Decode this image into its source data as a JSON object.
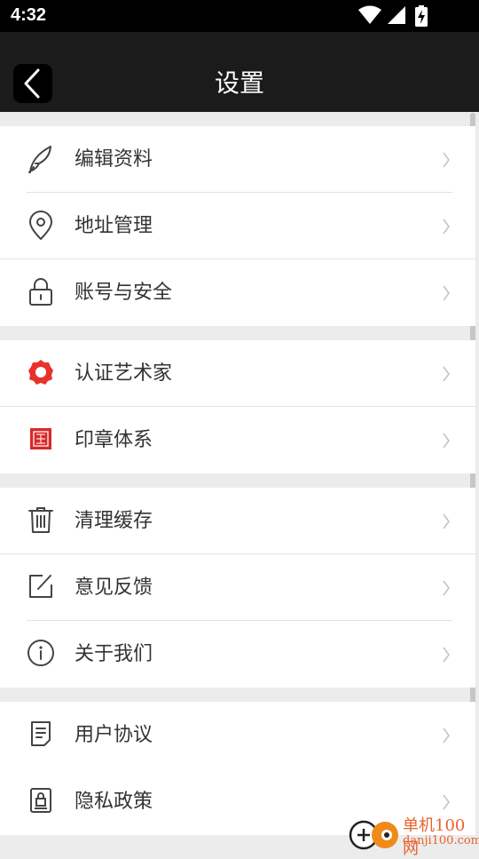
{
  "status_bar": {
    "time": "4:32"
  },
  "header": {
    "title": "设置",
    "back_icon": "chevron-left-icon"
  },
  "groups": [
    {
      "items": [
        {
          "label": "编辑资料",
          "icon": "quill-pen-icon"
        },
        {
          "label": "地址管理",
          "icon": "location-pin-icon"
        },
        {
          "label": "账号与安全",
          "icon": "padlock-icon"
        }
      ]
    },
    {
      "items": [
        {
          "label": "认证艺术家",
          "icon": "verified-badge-icon"
        },
        {
          "label": "印章体系",
          "icon": "seal-stamp-icon"
        }
      ]
    },
    {
      "items": [
        {
          "label": "清理缓存",
          "icon": "trash-can-icon"
        },
        {
          "label": "意见反馈",
          "icon": "edit-note-icon"
        },
        {
          "label": "关于我们",
          "icon": "info-icon"
        }
      ]
    },
    {
      "items": [
        {
          "label": "用户协议",
          "icon": "document-icon"
        },
        {
          "label": "隐私政策",
          "icon": "privacy-lock-document-icon"
        }
      ]
    }
  ],
  "watermark": {
    "line1": "单机100网",
    "line2": "danji100.com"
  },
  "colors": {
    "title_bar": "#1b1b1b",
    "verified_red": "#e8322c",
    "seal_red": "#d62a2a",
    "watermark": "#e8632d"
  }
}
